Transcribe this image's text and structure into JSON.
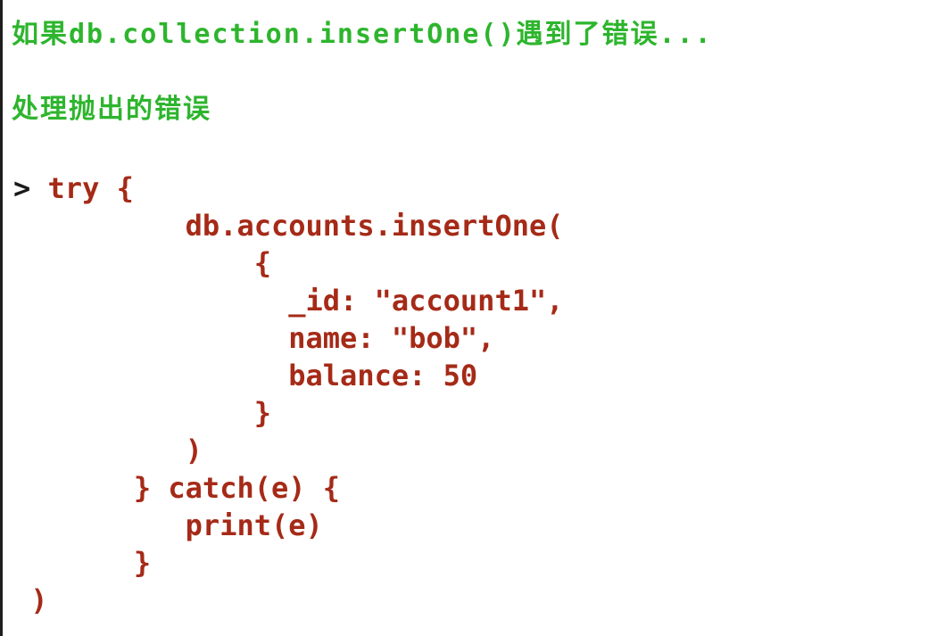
{
  "headings": {
    "line1": "如果db.collection.insertOne()遇到了错误...",
    "line2": "处理抛出的错误"
  },
  "code": {
    "prompt": ">",
    "lines": [
      " try {",
      "          db.accounts.insertOne(",
      "              {",
      "                _id: \"account1\",",
      "                name: \"bob\",",
      "                balance: 50",
      "              }",
      "          )",
      "       } catch(e) {",
      "          print(e)",
      "       }",
      " )"
    ]
  },
  "colors": {
    "heading": "#2db52d",
    "code": "#a52a17",
    "prompt": "#1a1a1a",
    "background": "#ffffff"
  }
}
